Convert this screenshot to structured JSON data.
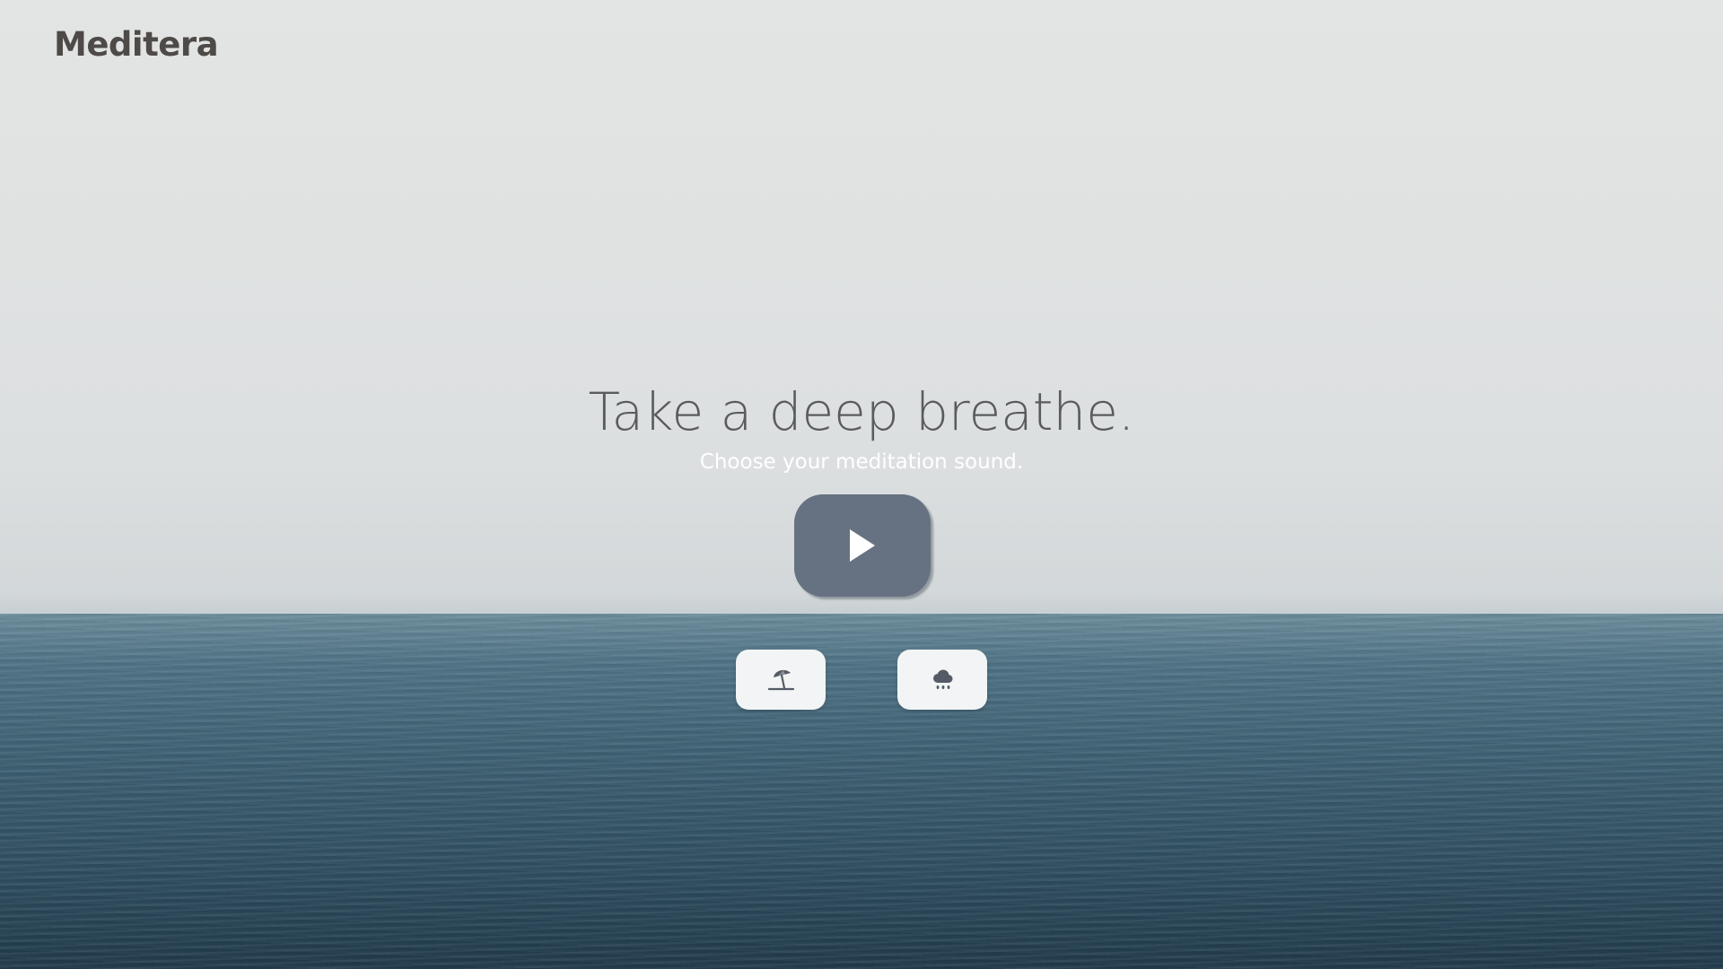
{
  "brand": {
    "name": "Meditera"
  },
  "hero": {
    "headline": "Take a deep breathe.",
    "subtitle": "Choose your meditation sound."
  },
  "controls": {
    "play_icon": "play-icon",
    "sounds": [
      {
        "icon": "beach-umbrella-icon"
      },
      {
        "icon": "rain-cloud-icon"
      }
    ]
  },
  "colors": {
    "play_button": "#667282",
    "sound_button": "#f3f4f5",
    "icon": "#555b66",
    "logo": "#4e4a48"
  }
}
